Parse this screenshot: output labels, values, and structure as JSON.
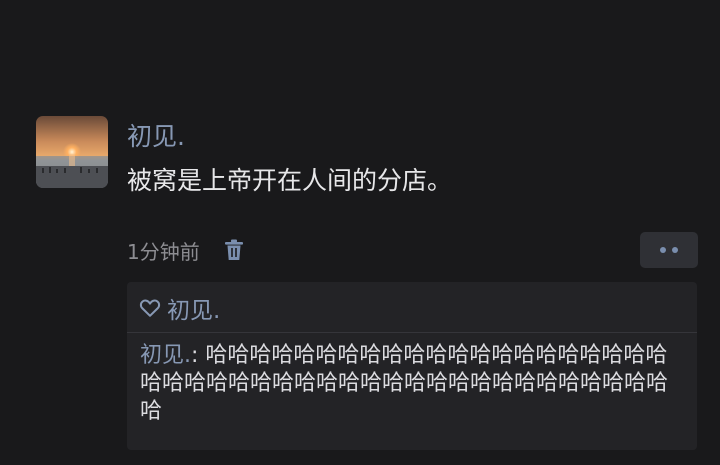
{
  "post": {
    "author": "初见.",
    "content": "被窝是上帝开在人间的分店。",
    "time": "1分钟前",
    "delete_icon": "trash-icon",
    "more_icon": "more-dots-icon",
    "avatar_icon": "sunset-beach-avatar"
  },
  "likes": {
    "icon": "heart-outline-icon",
    "users": [
      "初见."
    ]
  },
  "comments": [
    {
      "author": "初见.",
      "separator": ": ",
      "text": "哈哈哈哈哈哈哈哈哈哈哈哈哈哈哈哈哈哈哈哈哈哈哈哈哈哈哈哈哈哈哈哈哈哈哈哈哈哈哈哈哈哈哈哈哈哈"
    }
  ],
  "colors": {
    "background": "#19191b",
    "link": "#8798b4",
    "text": "#e7e7e9",
    "muted": "#8d8d92",
    "reply_bg": "#232326"
  }
}
